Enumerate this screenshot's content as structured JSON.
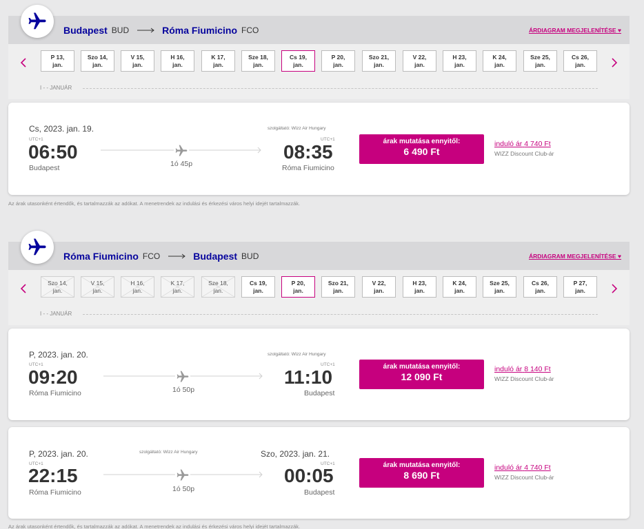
{
  "colors": {
    "brand_blue": "#06049d",
    "accent_magenta": "#c6007e",
    "background": "#e9e9ea"
  },
  "outbound": {
    "origin_city": "Budapest",
    "origin_code": "BUD",
    "dest_city": "Róma Fiumicino",
    "dest_code": "FCO",
    "chart_link": "ÁRDIAGRAM MEGJELENÍTÉSE",
    "month_label": "JANUÁR",
    "dates": [
      {
        "day": "P 13,",
        "month": "jan."
      },
      {
        "day": "Szo 14,",
        "month": "jan."
      },
      {
        "day": "V 15,",
        "month": "jan."
      },
      {
        "day": "H 16,",
        "month": "jan."
      },
      {
        "day": "K 17,",
        "month": "jan."
      },
      {
        "day": "Sze 18,",
        "month": "jan."
      },
      {
        "day": "Cs 19,",
        "month": "jan."
      },
      {
        "day": "P 20,",
        "month": "jan."
      },
      {
        "day": "Szo 21,",
        "month": "jan."
      },
      {
        "day": "V 22,",
        "month": "jan."
      },
      {
        "day": "H 23,",
        "month": "jan."
      },
      {
        "day": "K 24,",
        "month": "jan."
      },
      {
        "day": "Sze 25,",
        "month": "jan."
      },
      {
        "day": "Cs 26,",
        "month": "jan."
      }
    ],
    "flights": [
      {
        "dep_date": "Cs, 2023. jan. 19.",
        "arr_date": "",
        "operator": "szolgáltató: Wizz Air Hungary",
        "dep_utc": "UTC+1",
        "dep_time": "06:50",
        "dep_city": "Budapest",
        "duration": "1ó 45p",
        "arr_utc": "UTC+1",
        "arr_time": "08:35",
        "arr_city": "Róma Fiumicino",
        "price_label": "árak mutatása ennyitől:",
        "price": "6 490 Ft",
        "club_prefix": "induló ár",
        "club_price": "4 740 Ft",
        "club_label": "WIZZ Discount Club-ár"
      }
    ],
    "footnote": "Az árak utasonként értendők, és tartalmazzák az adókat. A menetrendek az indulási és érkezési város helyi idejét tartalmazzák."
  },
  "return": {
    "origin_city": "Róma Fiumicino",
    "origin_code": "FCO",
    "dest_city": "Budapest",
    "dest_code": "BUD",
    "chart_link": "ÁRDIAGRAM MEGJELENÍTÉSE",
    "month_label": "JANUÁR",
    "dates": [
      {
        "day": "Szo 14,",
        "month": "jan."
      },
      {
        "day": "V 15,",
        "month": "jan."
      },
      {
        "day": "H 16,",
        "month": "jan."
      },
      {
        "day": "K 17,",
        "month": "jan."
      },
      {
        "day": "Sze 18,",
        "month": "jan."
      },
      {
        "day": "Cs 19,",
        "month": "jan."
      },
      {
        "day": "P 20,",
        "month": "jan."
      },
      {
        "day": "Szo 21,",
        "month": "jan."
      },
      {
        "day": "V 22,",
        "month": "jan."
      },
      {
        "day": "H 23,",
        "month": "jan."
      },
      {
        "day": "K 24,",
        "month": "jan."
      },
      {
        "day": "Sze 25,",
        "month": "jan."
      },
      {
        "day": "Cs 26,",
        "month": "jan."
      },
      {
        "day": "P 27,",
        "month": "jan."
      }
    ],
    "flights": [
      {
        "dep_date": "P, 2023. jan. 20.",
        "arr_date": "",
        "operator": "szolgáltató: Wizz Air Hungary",
        "dep_utc": "UTC+1",
        "dep_time": "09:20",
        "dep_city": "Róma Fiumicino",
        "duration": "1ó 50p",
        "arr_utc": "UTC+1",
        "arr_time": "11:10",
        "arr_city": "Budapest",
        "price_label": "árak mutatása ennyitől:",
        "price": "12 090 Ft",
        "club_prefix": "induló ár",
        "club_price": "8 140 Ft",
        "club_label": "WIZZ Discount Club-ár"
      },
      {
        "dep_date": "P, 2023. jan. 20.",
        "arr_date": "Szo, 2023. jan. 21.",
        "operator": "szolgáltató: Wizz Air Hungary",
        "dep_utc": "UTC+1",
        "dep_time": "22:15",
        "dep_city": "Róma Fiumicino",
        "duration": "1ó 50p",
        "arr_utc": "UTC+1",
        "arr_time": "00:05",
        "arr_city": "Budapest",
        "price_label": "árak mutatása ennyitől:",
        "price": "8 690 Ft",
        "club_prefix": "induló ár",
        "club_price": "4 740 Ft",
        "club_label": "WIZZ Discount Club-ár"
      }
    ],
    "footnote": "Az árak utasonként értendők, és tartalmazzák az adókat. A menetrendek az indulási és érkezési város helyi idejét tartalmazzák."
  }
}
